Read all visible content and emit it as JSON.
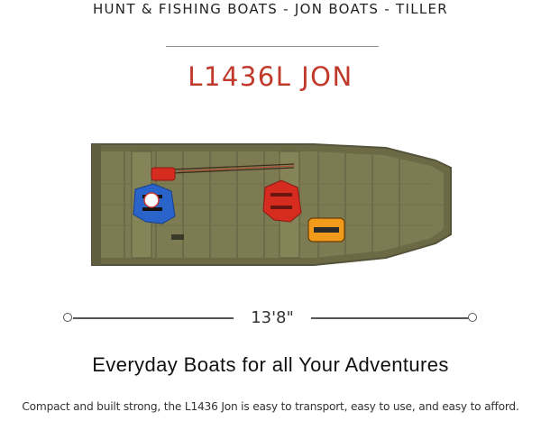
{
  "breadcrumb": "HUNT & FISHING BOATS - JON BOATS - TILLER",
  "model": {
    "title": "L1436L JON"
  },
  "boat_image": {
    "alt": "L1436L JON boat top view"
  },
  "length": {
    "label": "13'8\""
  },
  "headline": "Everyday Boats for all Your Adventures",
  "description": "Compact and built strong, the L1436 Jon is easy to transport, easy to use, and easy to afford.",
  "colors": {
    "title_accent": "#c0392b",
    "hull": "#6b6a45",
    "hull_floor": "#7d7b52",
    "life_vest_blue": "#2a63c9",
    "life_vest_red": "#d62b1f",
    "bag_orange": "#f29a1a"
  }
}
